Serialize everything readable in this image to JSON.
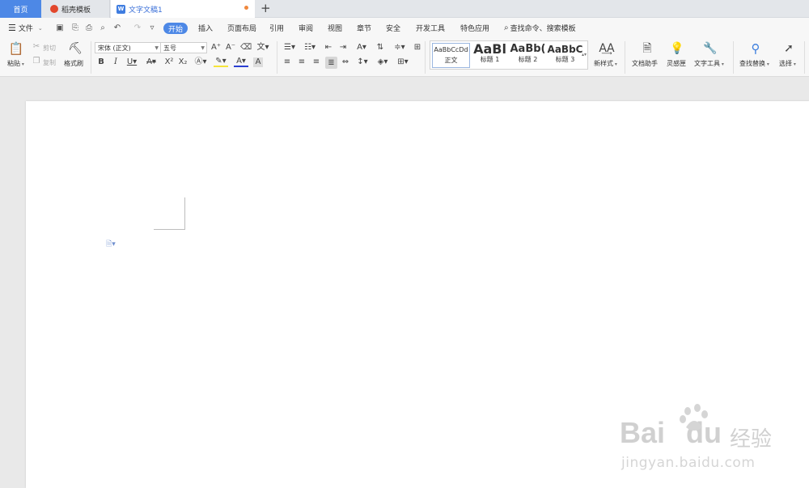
{
  "tabs": {
    "home": "首页",
    "template": "稻壳模板",
    "document": "文字文稿1",
    "new_tab": "+"
  },
  "menu": {
    "file": "文件",
    "items": [
      "开始",
      "插入",
      "页面布局",
      "引用",
      "审阅",
      "视图",
      "章节",
      "安全",
      "开发工具",
      "特色应用"
    ],
    "search": "查找命令、搜索模板"
  },
  "ribbon": {
    "paste": "粘贴",
    "cut": "剪切",
    "copy": "复制",
    "format_painter": "格式刷",
    "font_name": "宋体 (正文)",
    "font_size": "五号",
    "styles": [
      {
        "sample": "AaBbCcDd",
        "name": "正文"
      },
      {
        "sample": "AaBl",
        "name": "标题 1"
      },
      {
        "sample": "AaBb(",
        "name": "标题 2"
      },
      {
        "sample": "AaBbC",
        "name": "标题 3"
      }
    ],
    "new_style": "新样式",
    "doc_assistant": "文档助手",
    "inspiration": "灵感匣",
    "text_tools": "文字工具",
    "find_replace": "查找替换",
    "select": "选择"
  },
  "watermark": {
    "brand": "Bai",
    "brand2": "du",
    "cn": "经验",
    "url": "jingyan.baidu.com"
  },
  "colors": {
    "accent": "#4d88e6",
    "tab_active_text": "#3a6fd8",
    "dirty_dot": "#f0883d"
  }
}
